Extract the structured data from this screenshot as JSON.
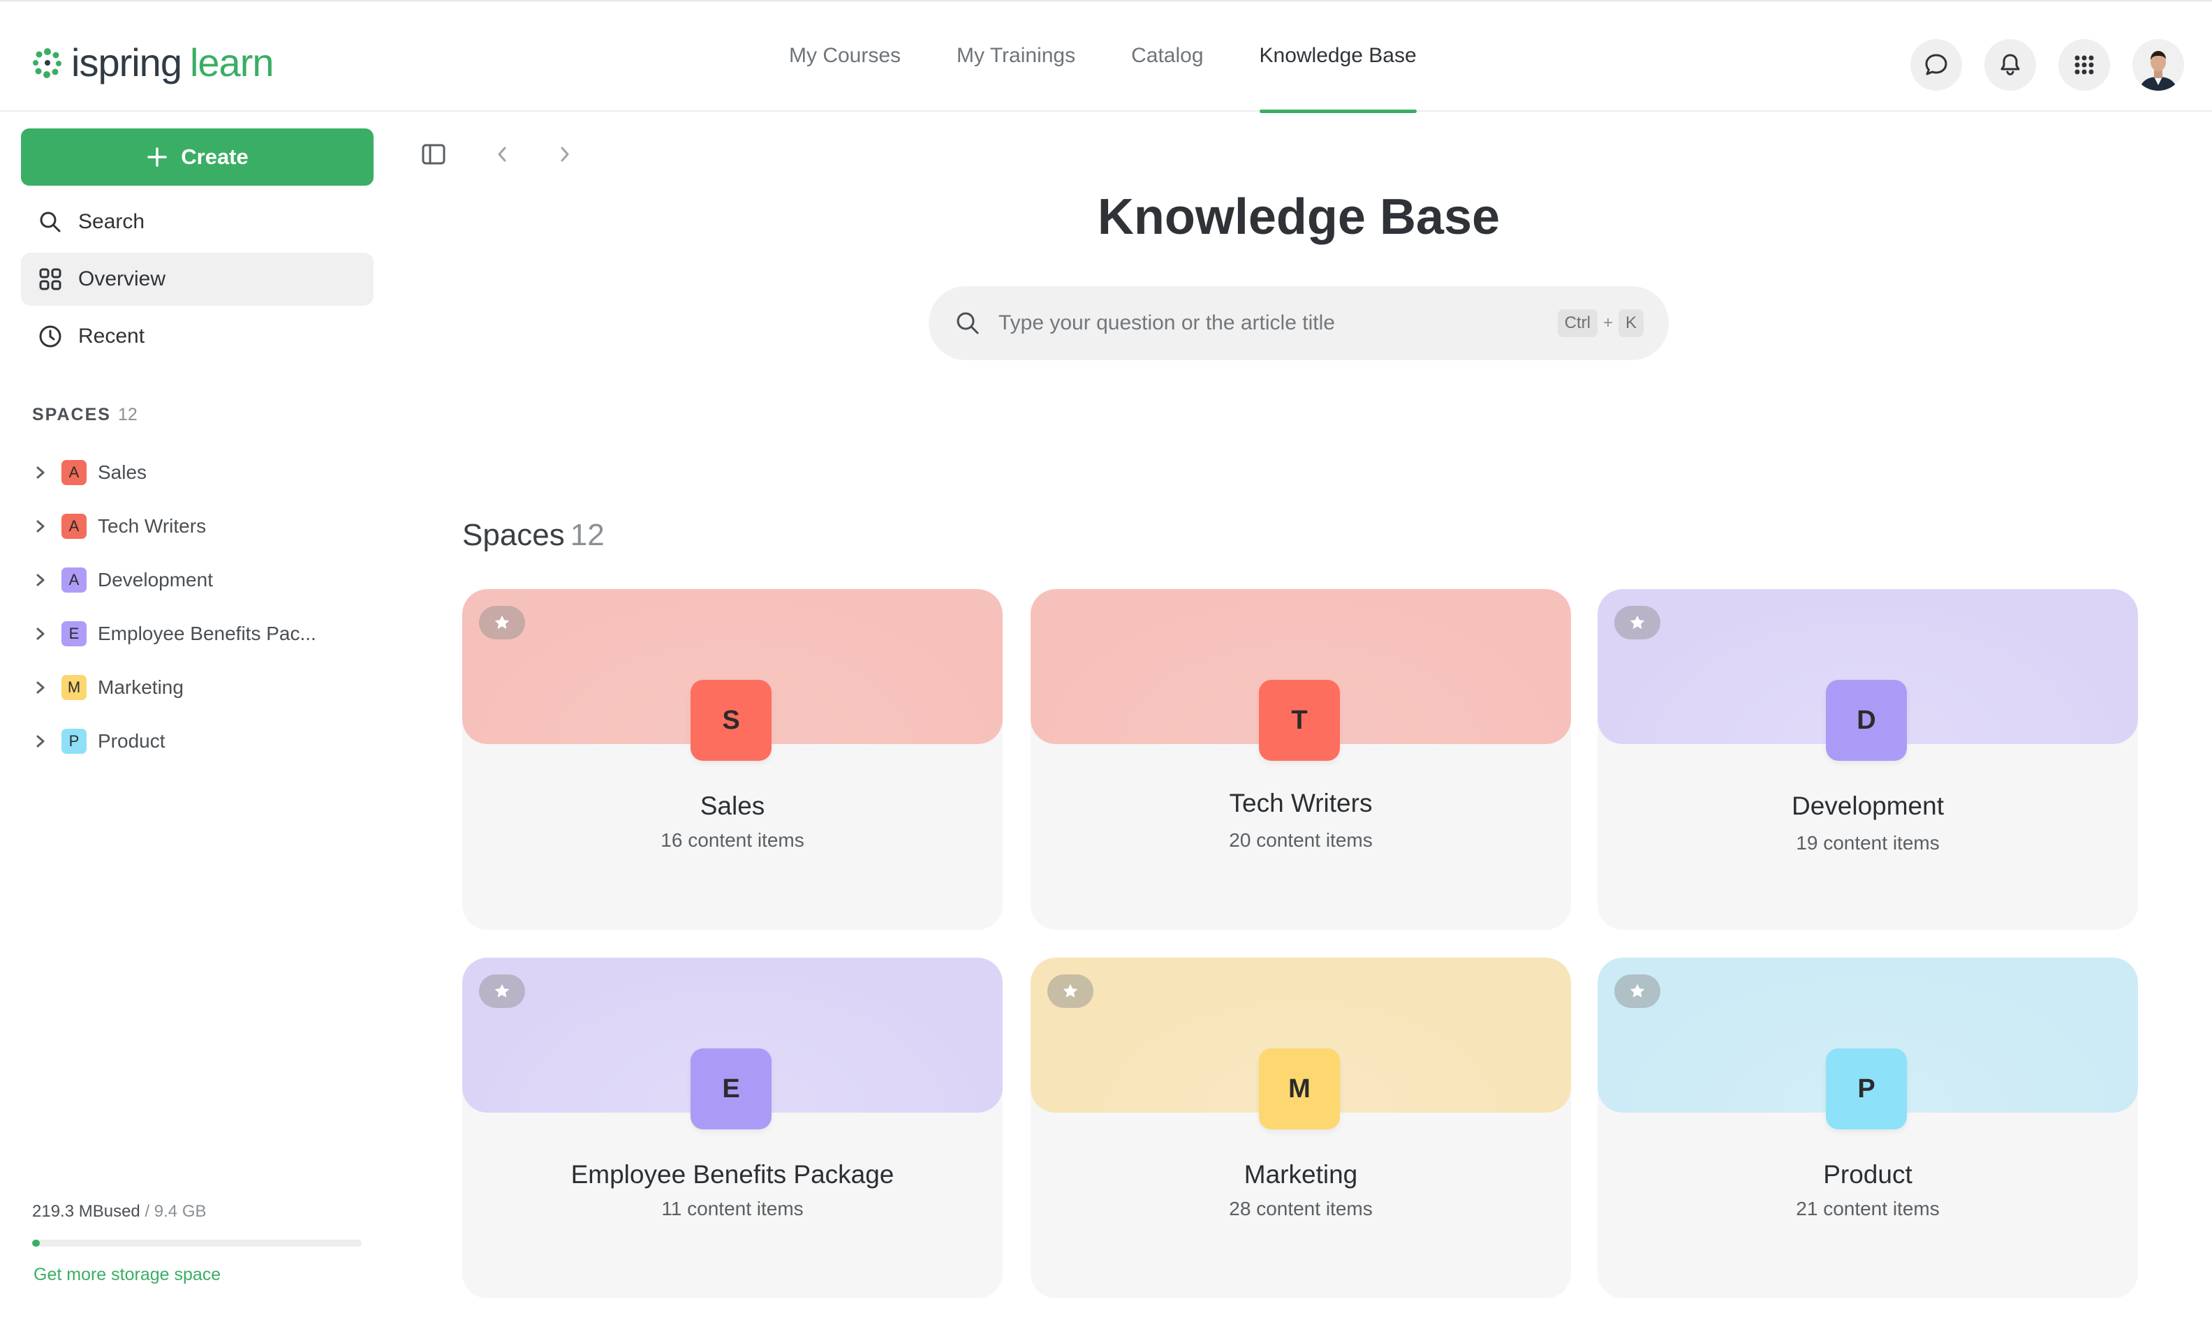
{
  "app": {
    "logo_word1": "ispring",
    "logo_word2": "learn",
    "brand_color": "#3aae64"
  },
  "nav": {
    "items": [
      {
        "label": "My Courses"
      },
      {
        "label": "My Trainings"
      },
      {
        "label": "Catalog"
      },
      {
        "label": "Knowledge Base",
        "active": true
      }
    ]
  },
  "header_icons": [
    "chat-icon",
    "bell-icon",
    "apps-grid-icon",
    "user-avatar"
  ],
  "sidebar": {
    "create_label": "Create",
    "items": [
      {
        "label": "Search",
        "icon": "search-icon"
      },
      {
        "label": "Overview",
        "icon": "grid-icon",
        "active": true
      },
      {
        "label": "Recent",
        "icon": "clock-icon"
      }
    ],
    "spaces_header": "SPACES",
    "spaces_count": "12",
    "spaces": [
      {
        "letter": "A",
        "label": "Sales",
        "color": "#f26d5b"
      },
      {
        "letter": "A",
        "label": "Tech Writers",
        "color": "#f26d5b"
      },
      {
        "letter": "A",
        "label": "Development",
        "color": "#ae9cf7"
      },
      {
        "letter": "E",
        "label": "Employee Benefits Pac...",
        "color": "#ae9cf7"
      },
      {
        "letter": "M",
        "label": "Marketing",
        "color": "#fcd66e"
      },
      {
        "letter": "P",
        "label": "Product",
        "color": "#8fe0f7"
      }
    ],
    "storage_used": "219.3 MBused",
    "storage_total": " / 9.4 GB",
    "storage_fraction": 0.023,
    "storage_link": "Get more storage space"
  },
  "main": {
    "title": "Knowledge Base",
    "search_placeholder": "Type your question or the article title",
    "kbd_ctrl": "Ctrl",
    "kbd_plus": "+",
    "kbd_k": "K",
    "spaces_title": "Spaces",
    "spaces_count": "12",
    "cards": [
      {
        "letter": "S",
        "name": "Sales",
        "count": "16 content items",
        "badge": "#fd6e5e",
        "starred": true,
        "top_from": "#f7c6c1",
        "top_to": "#f7c1bb"
      },
      {
        "letter": "T",
        "name": "Tech Writers",
        "count": "20 content items",
        "badge": "#fd6e5e",
        "starred": false,
        "top_from": "#f7c6c1",
        "top_to": "#f7c1bb"
      },
      {
        "letter": "D",
        "name": "Development",
        "count": "19 content items",
        "badge": "#ac9bf6",
        "starred": true,
        "top_from": "#e1dbf8",
        "top_to": "#dcd4f7"
      },
      {
        "letter": "E",
        "name": "Employee Benefits Package",
        "count": "11 content items",
        "badge": "#ac9bf6",
        "starred": true,
        "top_from": "#e1dbf8",
        "top_to": "#dcd4f7"
      },
      {
        "letter": "M",
        "name": "Marketing",
        "count": "28 content items",
        "badge": "#fdd770",
        "starred": true,
        "top_from": "#f8e8c2",
        "top_to": "#f7e4b8"
      },
      {
        "letter": "P",
        "name": "Product",
        "count": "21 content items",
        "badge": "#8de1f8",
        "starred": true,
        "top_from": "#d3eef7",
        "top_to": "#ccebf6"
      }
    ]
  }
}
